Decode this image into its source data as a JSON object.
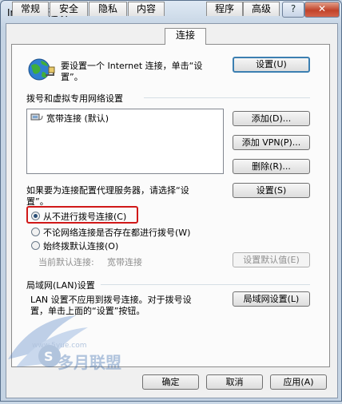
{
  "window": {
    "title": "Internet 选项",
    "help_glyph": "?",
    "close_glyph": "✕"
  },
  "tabs": [
    {
      "label": "常规"
    },
    {
      "label": "安全"
    },
    {
      "label": "隐私"
    },
    {
      "label": "内容"
    },
    {
      "label": "连接",
      "active": true
    },
    {
      "label": "程序"
    },
    {
      "label": "高级"
    }
  ],
  "setup": {
    "text_line1": "要设置一个 Internet 连接，单击“设",
    "text_line2": "置”。",
    "button": "设置(U)"
  },
  "dialup": {
    "heading": "拨号和虚拟专用网络设置",
    "items": [
      {
        "label": "宽带连接 (默认)"
      }
    ],
    "add_button": "添加(D)...",
    "add_vpn_button": "添加 VPN(P)...",
    "remove_button": "删除(R)...",
    "proxy_text_line1": "如果要为连接配置代理服务器，请选择“设",
    "proxy_text_line2": "置”。",
    "settings_button": "设置(S)",
    "options": [
      {
        "label": "从不进行拨号连接(C)",
        "checked": true
      },
      {
        "label": "不论网络连接是否存在都进行拨号(W)",
        "checked": false
      },
      {
        "label": "始终拨默认连接(O)",
        "checked": false
      }
    ],
    "current_default_label": "当前默认连接:",
    "current_default_value": "宽带连接",
    "set_default_button": "设置默认值(E)"
  },
  "lan": {
    "heading": "局域网(LAN)设置",
    "text_line1": "LAN 设置不应用到拨号连接。对于拨号设",
    "text_line2": "置，单击上面的“设置”按钮。",
    "button": "局域网设置(L)"
  },
  "footer": {
    "ok": "确定",
    "cancel": "取消",
    "apply": "应用(A)"
  },
  "watermark": {
    "text": "多月联盟",
    "url": "www.5yue.com"
  },
  "colors": {
    "highlight_box": "#d01818",
    "default_button_border": "#3c7fb1"
  }
}
